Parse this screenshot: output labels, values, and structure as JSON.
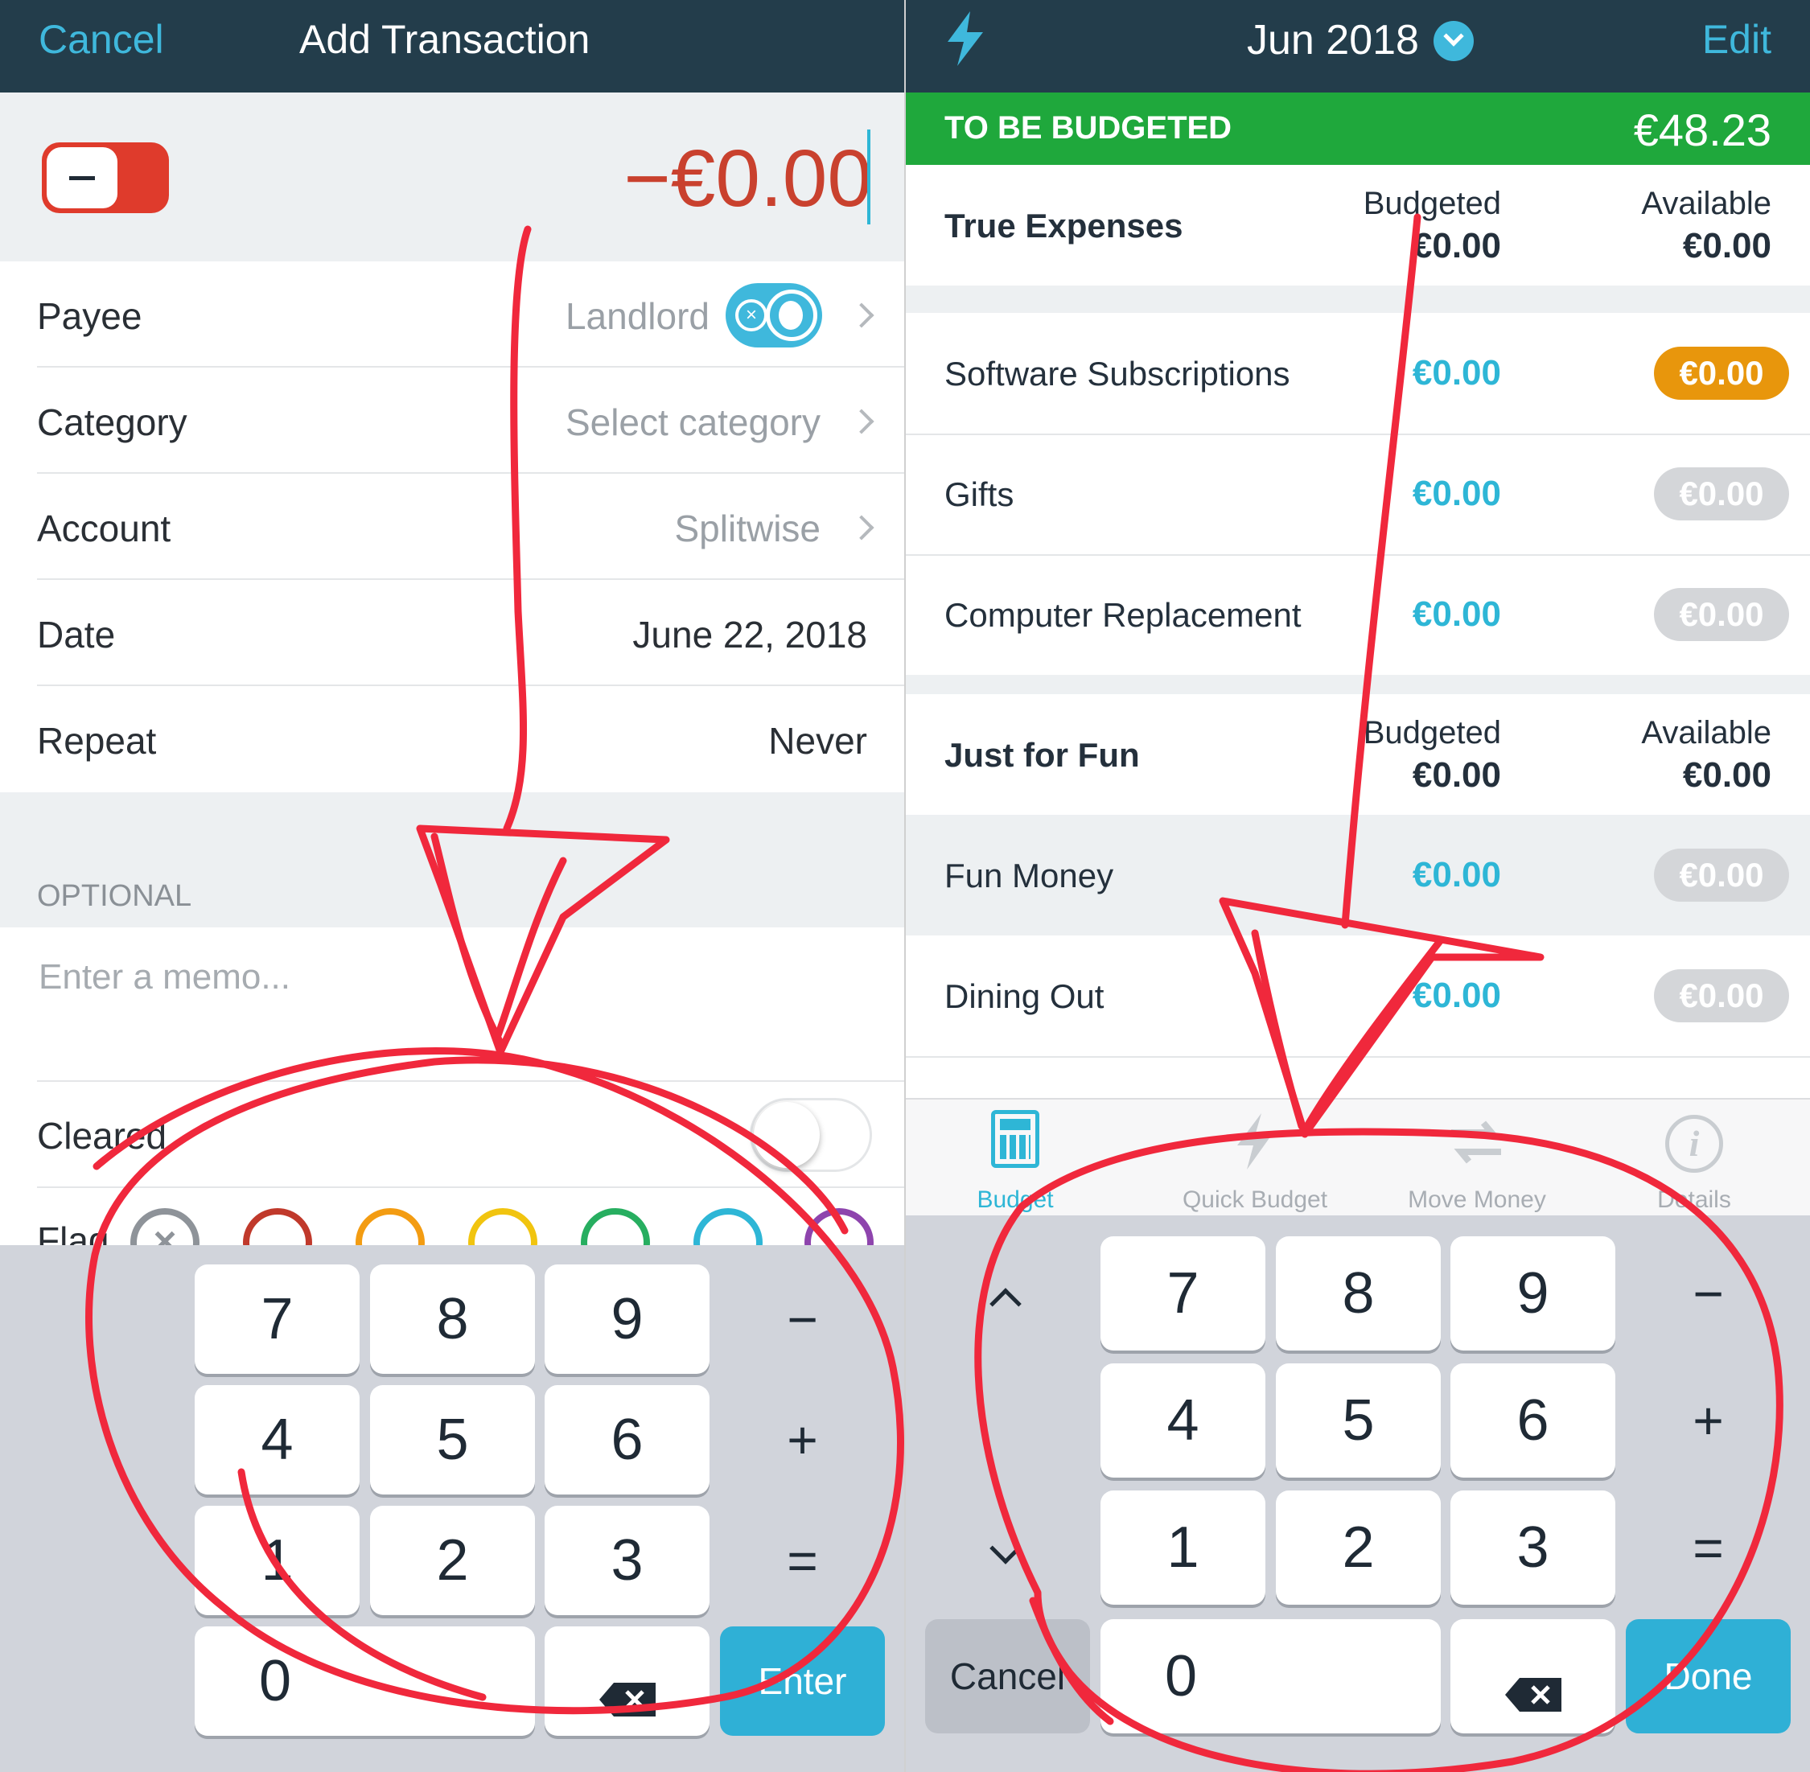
{
  "left": {
    "nav": {
      "cancel": "Cancel",
      "title": "Add Transaction"
    },
    "amount": "−€0.00",
    "fields": [
      {
        "label": "Payee",
        "value": "Landlord"
      },
      {
        "label": "Category",
        "value": "Select category"
      },
      {
        "label": "Account",
        "value": "Splitwise"
      },
      {
        "label": "Date",
        "value": "June 22, 2018"
      },
      {
        "label": "Repeat",
        "value": "Never"
      }
    ],
    "optional_header": "OPTIONAL",
    "memo_placeholder": "Enter a memo...",
    "cleared_label": "Cleared",
    "flag_label": "Flag",
    "flag_colors": [
      "#c0392b",
      "#f39c12",
      "#f1c40f",
      "#27ae60",
      "#2eb6d6",
      "#8e44ad"
    ],
    "keypad": {
      "keys": [
        "7",
        "8",
        "9",
        "4",
        "5",
        "6",
        "1",
        "2",
        "3",
        "0"
      ],
      "ops": [
        "−",
        "+",
        "="
      ],
      "enter": "Enter"
    }
  },
  "right": {
    "nav": {
      "month": "Jun 2018",
      "edit": "Edit"
    },
    "tbb": {
      "label": "TO BE BUDGETED",
      "amount": "€48.23"
    },
    "groups": [
      {
        "name": "True Expenses",
        "budgeted_label": "Budgeted",
        "budgeted": "€0.00",
        "available_label": "Available",
        "available": "€0.00",
        "categories": [
          {
            "name": "Software Subscriptions",
            "budgeted": "€0.00",
            "available": "€0.00",
            "status": "warning"
          },
          {
            "name": "Gifts",
            "budgeted": "€0.00",
            "available": "€0.00",
            "status": "zero"
          },
          {
            "name": "Computer Replacement",
            "budgeted": "€0.00",
            "available": "€0.00",
            "status": "zero"
          }
        ]
      },
      {
        "name": "Just for Fun",
        "budgeted_label": "Budgeted",
        "budgeted": "€0.00",
        "available_label": "Available",
        "available": "€0.00",
        "categories": [
          {
            "name": "Fun Money",
            "budgeted": "€0.00",
            "available": "€0.00",
            "status": "zero"
          },
          {
            "name": "Dining Out",
            "budgeted": "€0.00",
            "available": "€0.00",
            "status": "zero"
          }
        ]
      }
    ],
    "tabs": [
      "Budget",
      "Quick Budget",
      "Move Money",
      "Details"
    ],
    "keypad": {
      "keys": [
        "7",
        "8",
        "9",
        "4",
        "5",
        "6",
        "1",
        "2",
        "3",
        "0"
      ],
      "ops": [
        "−",
        "+",
        "="
      ],
      "cancel": "Cancel",
      "done": "Done"
    }
  },
  "colors": {
    "nav_bg": "#233d4b",
    "accent": "#3fb8dc",
    "tbb_green": "#1fa83c",
    "amount_red": "#c9412e",
    "warning_orange": "#e8960c",
    "zero_gray": "#d4d6d9",
    "annotation_red": "#f0283c"
  }
}
